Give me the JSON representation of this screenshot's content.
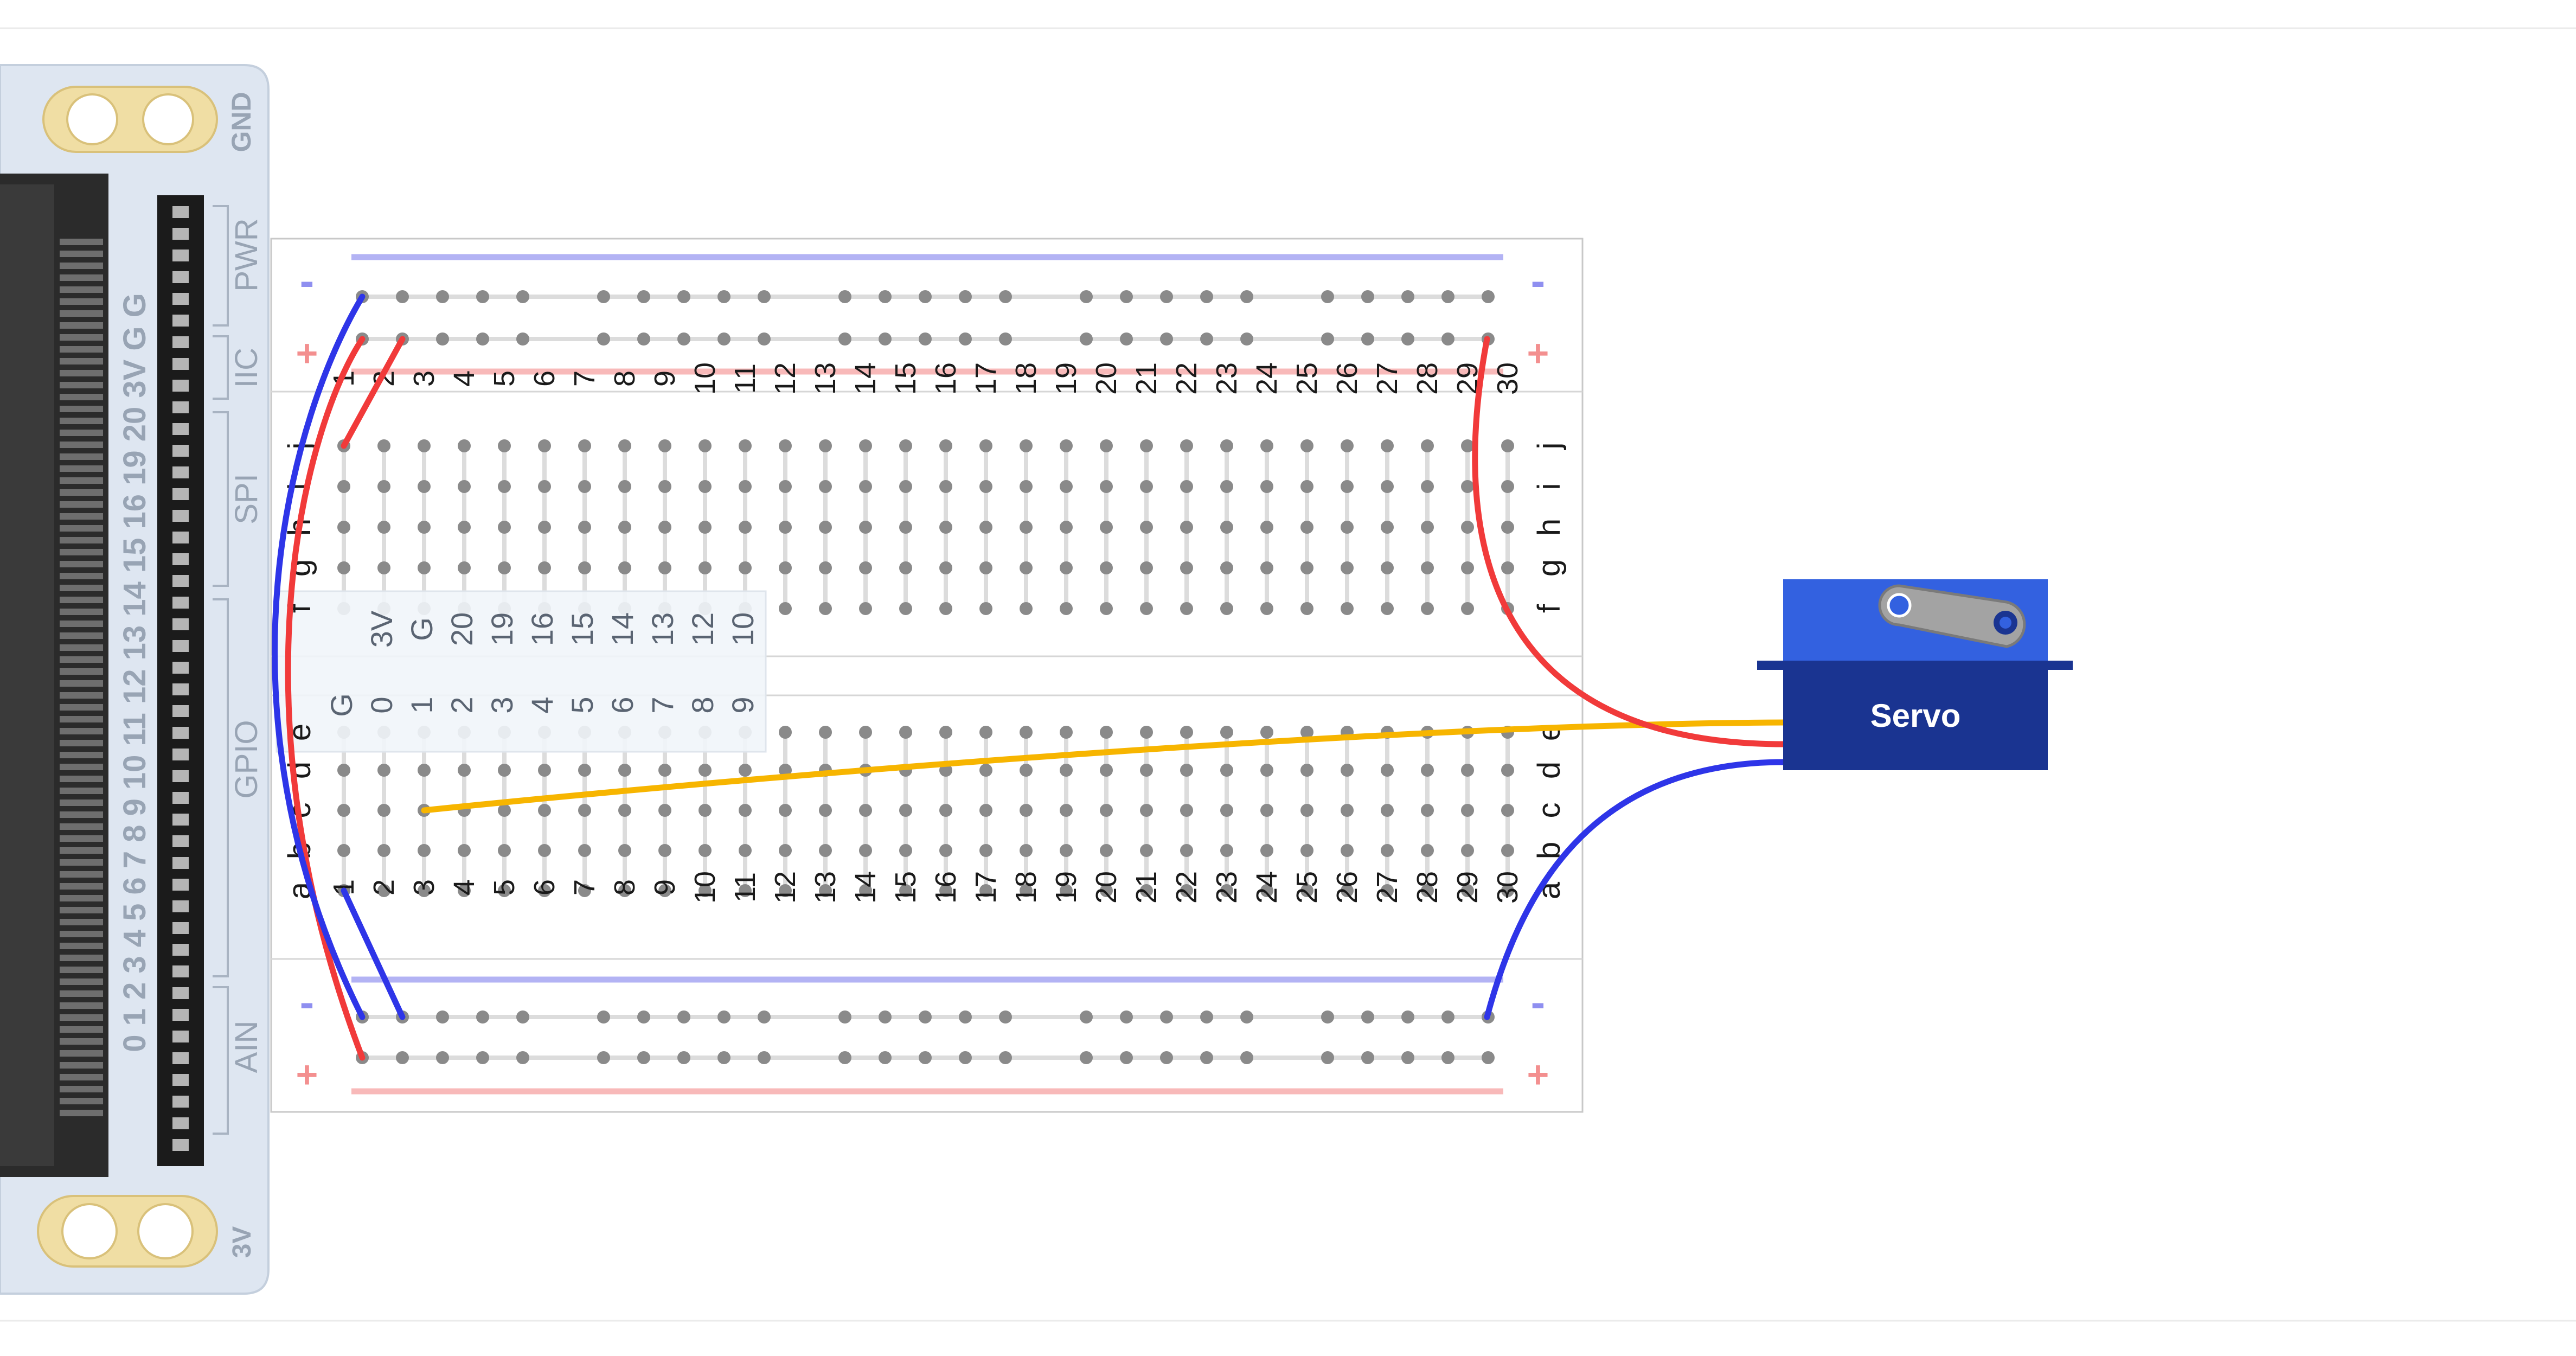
{
  "breadboard": {
    "columns": [
      "1",
      "2",
      "3",
      "4",
      "5",
      "6",
      "7",
      "8",
      "9",
      "10",
      "11",
      "12",
      "13",
      "14",
      "15",
      "16",
      "17",
      "18",
      "19",
      "20",
      "21",
      "22",
      "23",
      "24",
      "25",
      "26",
      "27",
      "28",
      "29",
      "30"
    ],
    "rows_top": [
      "j",
      "i",
      "h",
      "g",
      "f"
    ],
    "rows_bottom": [
      "e",
      "d",
      "c",
      "b",
      "a"
    ],
    "rail_minus": "-",
    "rail_plus": "+"
  },
  "pin_legend": {
    "row_top": [
      "3V",
      "G",
      "20",
      "19",
      "16",
      "15",
      "14",
      "13",
      "12",
      "10"
    ],
    "row_bottom": [
      "G",
      "0",
      "1",
      "2",
      "3",
      "4",
      "5",
      "6",
      "7",
      "8",
      "9"
    ],
    "side_labels": [
      "f",
      "e"
    ]
  },
  "edge_connector": {
    "silkscreen_pins": "0 1 2 3 4 5 6 7 8 9 10 11 12 13 14 15 16 19 20 3V G G",
    "section_labels": [
      "PWR",
      "IIC",
      "SPI",
      "GPIO",
      "AIN"
    ],
    "gnd_label": "GND",
    "v_label": "3V"
  },
  "servo": {
    "label": "Servo",
    "body_color": "#1a3491",
    "top_color": "#3361e0",
    "horn_color": "#a3a3a3"
  },
  "wire_colors": {
    "red": "#f13a3a",
    "blue": "#2e35e8",
    "yellow": "#f7b500"
  }
}
